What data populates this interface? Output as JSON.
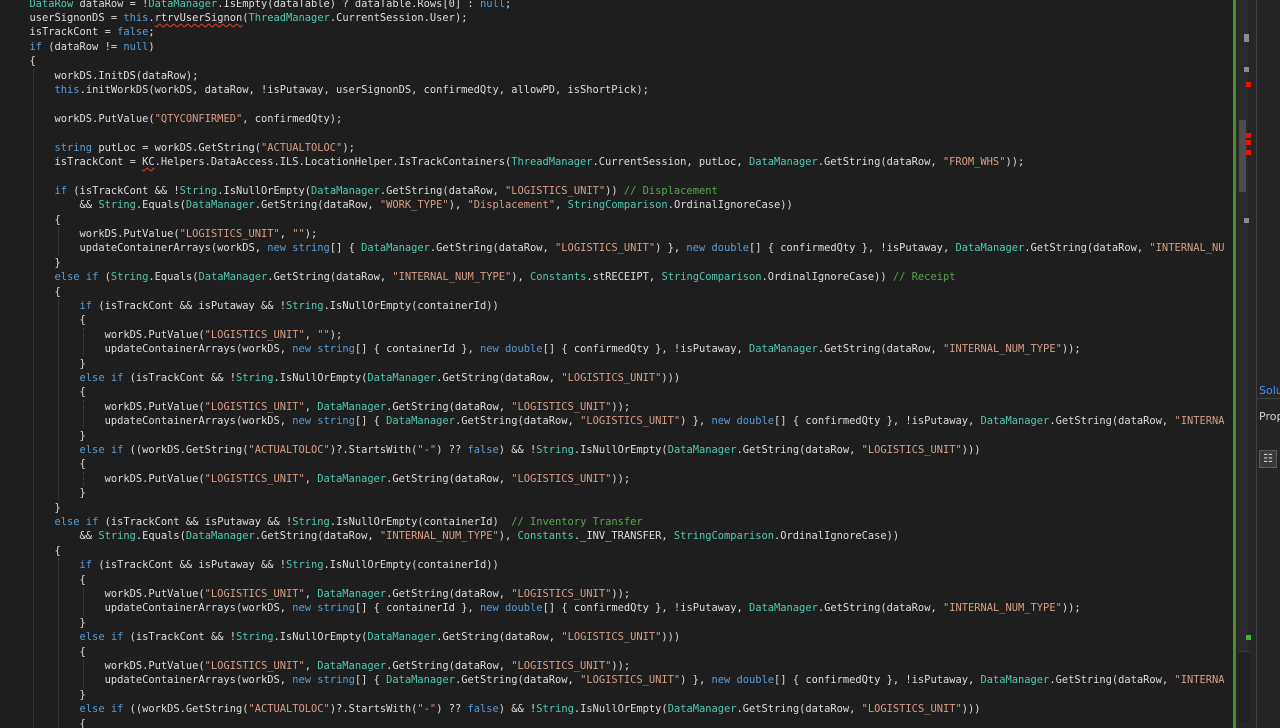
{
  "code_lines": [
    "DataRow dataRow = !DataManager.IsEmpty(dataTable) ? dataTable.Rows[0] : null;",
    "userSignonDS = this.rtrvUserSignon(ThreadManager.CurrentSession.User);",
    "isTrackCont = false;",
    "if (dataRow != null)",
    "{",
    "    workDS.InitDS(dataRow);",
    "    this.initWorkDS(workDS, dataRow, !isPutaway, userSignonDS, confirmedQty, allowPD, isShortPick);",
    "",
    "    workDS.PutValue(\"QTYCONFIRMED\", confirmedQty);",
    "",
    "    string putLoc = workDS.GetString(\"ACTUALTOLOC\");",
    "    isTrackCont = KC.Helpers.DataAccess.ILS.LocationHelper.IsTrackContainers(ThreadManager.CurrentSession, putLoc, DataManager.GetString(dataRow, \"FROM_WHS\"));",
    "",
    "    if (isTrackCont && !String.IsNullOrEmpty(DataManager.GetString(dataRow, \"LOGISTICS_UNIT\")) // Displacement",
    "        && String.Equals(DataManager.GetString(dataRow, \"WORK_TYPE\"), \"Displacement\", StringComparison.OrdinalIgnoreCase))",
    "    {",
    "        workDS.PutValue(\"LOGISTICS_UNIT\", \"\");",
    "        updateContainerArrays(workDS, new string[] { DataManager.GetString(dataRow, \"LOGISTICS_UNIT\") }, new double[] { confirmedQty }, !isPutaway, DataManager.GetString(dataRow, \"INTERNAL_NU",
    "    }",
    "    else if (String.Equals(DataManager.GetString(dataRow, \"INTERNAL_NUM_TYPE\"), Constants.stRECEIPT, StringComparison.OrdinalIgnoreCase)) // Receipt",
    "    {",
    "        if (isTrackCont && isPutaway && !String.IsNullOrEmpty(containerId))",
    "        {",
    "            workDS.PutValue(\"LOGISTICS_UNIT\", \"\");",
    "            updateContainerArrays(workDS, new string[] { containerId }, new double[] { confirmedQty }, !isPutaway, DataManager.GetString(dataRow, \"INTERNAL_NUM_TYPE\"));",
    "        }",
    "        else if (isTrackCont && !String.IsNullOrEmpty(DataManager.GetString(dataRow, \"LOGISTICS_UNIT\")))",
    "        {",
    "            workDS.PutValue(\"LOGISTICS_UNIT\", DataManager.GetString(dataRow, \"LOGISTICS_UNIT\"));",
    "            updateContainerArrays(workDS, new string[] { DataManager.GetString(dataRow, \"LOGISTICS_UNIT\") }, new double[] { confirmedQty }, !isPutaway, DataManager.GetString(dataRow, \"INTERNA",
    "        }",
    "        else if ((workDS.GetString(\"ACTUALTOLOC\")?.StartsWith(\"-\") ?? false) && !String.IsNullOrEmpty(DataManager.GetString(dataRow, \"LOGISTICS_UNIT\")))",
    "        {",
    "            workDS.PutValue(\"LOGISTICS_UNIT\", DataManager.GetString(dataRow, \"LOGISTICS_UNIT\"));",
    "        }",
    "    }",
    "    else if (isTrackCont && isPutaway && !String.IsNullOrEmpty(containerId)  // Inventory Transfer",
    "        && String.Equals(DataManager.GetString(dataRow, \"INTERNAL_NUM_TYPE\"), Constants._INV_TRANSFER, StringComparison.OrdinalIgnoreCase))",
    "    {",
    "        if (isTrackCont && isPutaway && !String.IsNullOrEmpty(containerId))",
    "        {",
    "            workDS.PutValue(\"LOGISTICS_UNIT\", DataManager.GetString(dataRow, \"LOGISTICS_UNIT\"));",
    "            updateContainerArrays(workDS, new string[] { containerId }, new double[] { confirmedQty }, !isPutaway, DataManager.GetString(dataRow, \"INTERNAL_NUM_TYPE\"));",
    "        }",
    "        else if (isTrackCont && !String.IsNullOrEmpty(DataManager.GetString(dataRow, \"LOGISTICS_UNIT\")))",
    "        {",
    "            workDS.PutValue(\"LOGISTICS_UNIT\", DataManager.GetString(dataRow, \"LOGISTICS_UNIT\"));",
    "            updateContainerArrays(workDS, new string[] { DataManager.GetString(dataRow, \"LOGISTICS_UNIT\") }, new double[] { confirmedQty }, !isPutaway, DataManager.GetString(dataRow, \"INTERNA",
    "        }",
    "        else if ((workDS.GetString(\"ACTUALTOLOC\")?.StartsWith(\"-\") ?? false) && !String.IsNullOrEmpty(DataManager.GetString(dataRow, \"LOGISTICS_UNIT\")))",
    "        {"
  ],
  "side_panel": {
    "solution_tab": "Solu",
    "properties_tab": "Prop",
    "properties_tool_icon": "property-pages-icon"
  },
  "scrollbar_markers": [
    "red",
    "red",
    "red",
    "red",
    "grey",
    "grey",
    "grey",
    "grey",
    "green"
  ],
  "colors": {
    "background": "#1e1e1e",
    "keyword": "#569cd6",
    "type": "#4ec9b0",
    "string": "#d69d85",
    "comment": "#57a64a",
    "text": "#dcdcdc",
    "change_bar_saved": "#4c8c2c",
    "marker_error": "#e51400",
    "marker_info": "#8a8a8a",
    "marker_ok": "#2fbf2f"
  }
}
